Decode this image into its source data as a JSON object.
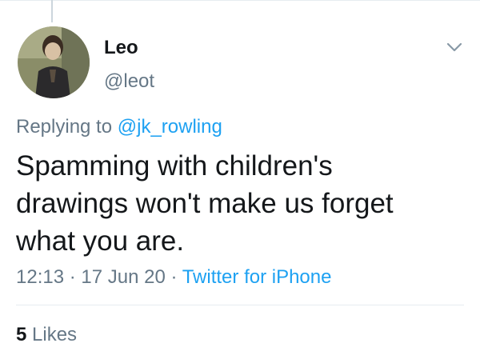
{
  "tweet": {
    "author": {
      "display_name": "Leo",
      "handle": "@leot"
    },
    "reply": {
      "prefix": "Replying to ",
      "mention": "@jk_rowling"
    },
    "text": "Spamming with children's drawings won't make us forget what you are.",
    "meta": {
      "time": "12:13",
      "separator": " · ",
      "date": "17 Jun 20",
      "source": "Twitter for iPhone"
    },
    "stats": {
      "likes_count": "5",
      "likes_label": " Likes"
    }
  },
  "icons": {
    "caret": "chevron-down-icon",
    "avatar": "avatar"
  },
  "colors": {
    "text_primary": "#14171a",
    "text_secondary": "#657786",
    "link_blue": "#1da1f2",
    "divider": "#e6ecf0"
  }
}
